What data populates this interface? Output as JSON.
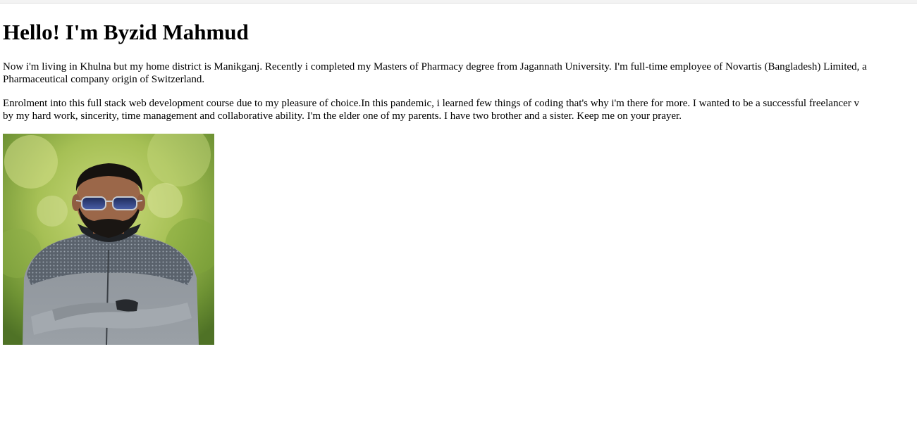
{
  "heading": "Hello! I'm Byzid Mahmud",
  "paragraph1": {
    "line1": "Now i'm living in Khulna but my home district is Manikganj. Recently i completed my Masters of Pharmacy degree from Jagannath University. I'm full-time employee of Novartis (Bangladesh) Limited, a",
    "line2": "Pharmaceutical company origin of Switzerland."
  },
  "paragraph2": {
    "line1": "Enrolment into this full stack web development course due to my pleasure of choice.In this pandemic, i learned few things of coding that's why i'm there for more. I wanted to be a successful freelancer v",
    "line2": "by my hard work, sincerity, time management and collaborative ability. I'm the elder one of my parents. I have two brother and a sister. Keep me on your prayer."
  },
  "photo": {
    "subject": "portrait of a bearded man with sunglasses and grey jacket, arms crossed, green blurred background"
  },
  "colors": {
    "background": "#ffffff",
    "text": "#000000"
  }
}
